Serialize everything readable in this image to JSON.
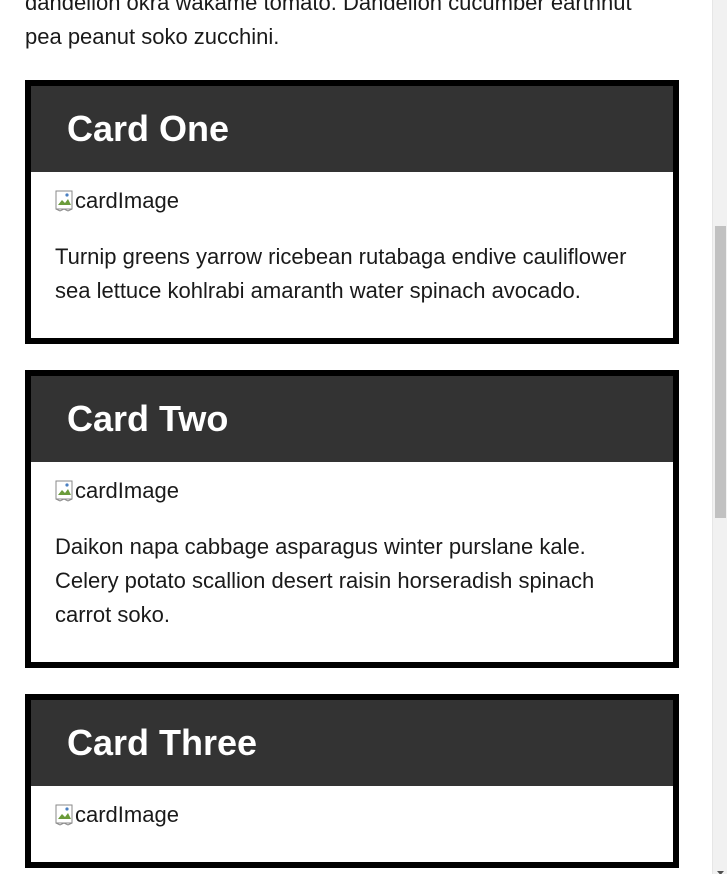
{
  "intro": {
    "text": "dandelion okra wakame tomato. Dandelion cucumber earthnut pea peanut soko zucchini."
  },
  "cards": [
    {
      "title": "Card One",
      "image_alt": "cardImage",
      "text": "Turnip greens yarrow ricebean rutabaga endive cauliflower sea lettuce kohlrabi amaranth water spinach avocado."
    },
    {
      "title": "Card Two",
      "image_alt": "cardImage",
      "text": "Daikon napa cabbage asparagus winter purslane kale. Celery potato scallion desert raisin horseradish spinach carrot soko."
    },
    {
      "title": "Card Three",
      "image_alt": "cardImage",
      "text": ""
    }
  ],
  "colors": {
    "card_header_bg": "#333333",
    "card_border": "#000000",
    "title_text": "#ffffff",
    "body_text": "#1a1a1a"
  },
  "icons": {
    "broken_image": "broken-image-icon",
    "scroll_down": "chevron-down-icon"
  }
}
